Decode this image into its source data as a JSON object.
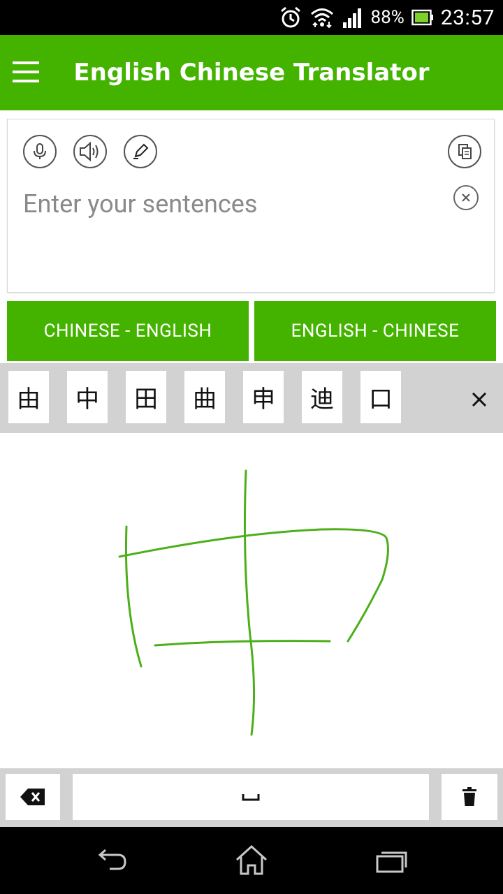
{
  "status_bar": {
    "battery_percent": "88%",
    "time": "23:57",
    "icons": [
      "alarm-clock-icon",
      "wifi-icon",
      "cell-signal-icon",
      "battery-icon"
    ]
  },
  "toolbar": {
    "title": "English Chinese Translator",
    "menu_icon": "hamburger-menu-icon"
  },
  "input": {
    "placeholder": "Enter your sentences",
    "value": "",
    "icons": [
      "microphone-icon",
      "speaker-icon",
      "pen-icon",
      "copy-icon",
      "clear-icon"
    ]
  },
  "language_buttons": {
    "chinese_english": "CHINESE - ENGLISH",
    "english_chinese": "ENGLISH - CHINESE"
  },
  "candidates": [
    "由",
    "中",
    "田",
    "曲",
    "申",
    "迪",
    "口"
  ],
  "keyboard": {
    "space_symbol": "␣",
    "icons": [
      "backspace-icon",
      "space-icon",
      "trash-icon"
    ]
  },
  "navigation": {
    "icons": [
      "back-icon",
      "home-icon",
      "recent-apps-icon"
    ]
  },
  "colors": {
    "primary_green": "#43b300",
    "stroke_green": "#4caf1a",
    "candidate_bar_gray": "#d2d2d2"
  }
}
